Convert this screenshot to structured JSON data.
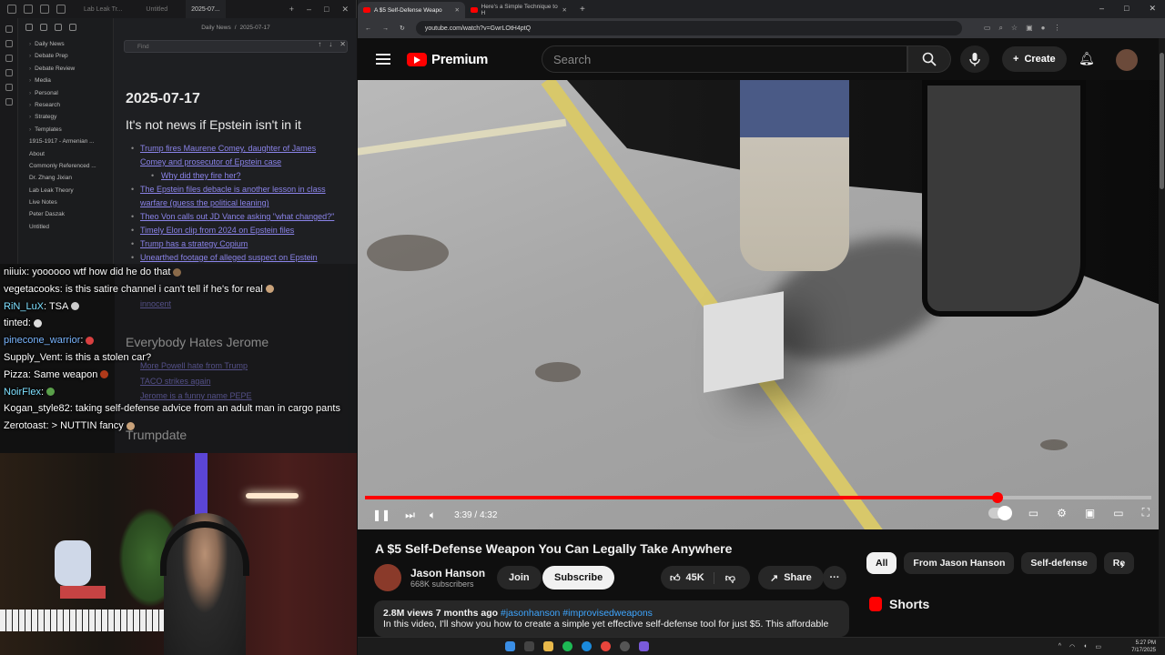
{
  "notes_app": {
    "tabs": [
      "Lab Leak Tr...",
      "Untitled",
      "2025-07..."
    ],
    "breadcrumb": [
      "Daily News",
      "/",
      "2025-07-17"
    ],
    "find_placeholder": "Find",
    "file_tree": [
      "Daily News",
      "Debate Prep",
      "Debate Review",
      "Media",
      "Personal",
      "Research",
      "Strategy",
      "Templates",
      "1915-1917 - Armenian ...",
      "About",
      "Commonly Referenced ...",
      "Dr. Zhang Jixian",
      "Lab Leak Theory",
      "Live Notes",
      "Peter Daszak",
      "Untitled"
    ],
    "file_tree_folders": 8,
    "date_heading": "2025-07-17",
    "section1_heading": "It's not news if Epstein isn't in it",
    "section1_links": [
      {
        "text": "Trump fires Maurene Comey, daughter of James Comey and prosecutor of Epstein case",
        "sub": false
      },
      {
        "text": "Why did they fire her?",
        "sub": true
      },
      {
        "text": "The Epstein files debacle is another lesson in class warfare (guess the political leaning)",
        "sub": false
      },
      {
        "text": "Theo Von calls out JD Vance asking \"what changed?\"",
        "sub": false
      },
      {
        "text": "Timely Elon clip from 2024 on Epstein files",
        "sub": false
      },
      {
        "text": "Trump has a strategy Copium",
        "sub": false
      },
      {
        "text": "Unearthed footage of alleged suspect on Epstein",
        "sub": false
      }
    ],
    "section1_tail": "innocent",
    "section2_heading": "Everybody Hates Jerome",
    "section2_links": [
      "More Powell hate from Trump",
      "TACO strikes again",
      "Jerome is a funny name PEPE"
    ],
    "section3_heading": "Trumpdate"
  },
  "chat": [
    {
      "user": "niiuix",
      "user_color": "#ffffff",
      "text": " yoooooo wtf how did he do that",
      "emote": "#8a6a4a"
    },
    {
      "user": "vegetacooks",
      "user_color": "#ffffff",
      "text": " is this satire channel i can't tell if he's for real",
      "emote": "#c9a27a"
    },
    {
      "user": "RiN_LuX",
      "user_color": "#7ee0ff",
      "text": " TSA",
      "emote": "#cccccc"
    },
    {
      "user": "tinted",
      "user_color": "#ffffff",
      "text": "",
      "emote": "#dddddd"
    },
    {
      "user": "pinecone_warrior",
      "user_color": "#7ab6ff",
      "text": "",
      "emote": "#d94040"
    },
    {
      "user": "Supply_Vent",
      "user_color": "#ffffff",
      "text": " is this a stolen car?",
      "emote": ""
    },
    {
      "user": "Pizza",
      "user_color": "#ffffff",
      "text": " Same weapon",
      "emote": "#b03a1a"
    },
    {
      "user": "NoirFlex",
      "user_color": "#7ee0ff",
      "text": "",
      "emote": "#5aa04a"
    },
    {
      "user": "Kogan_style82",
      "user_color": "#ffffff",
      "text": " taking self-defense advice from an adult man in cargo pants",
      "emote": ""
    },
    {
      "user": "Zerotoast",
      "user_color": "#ffffff",
      "text": " > NUTTIN fancy",
      "emote": "#c9a27a"
    }
  ],
  "browser": {
    "tabs": [
      {
        "title": "A $5 Self-Defense Weapo",
        "active": true
      },
      {
        "title": "Here's a Simple Technique to H",
        "active": false
      }
    ],
    "new_tab": "+",
    "url": "youtube.com/watch?v=GwrLOtH4ptQ",
    "window_controls": [
      "–",
      "□",
      "✕"
    ]
  },
  "youtube": {
    "brand": "Premium",
    "search_placeholder": "Search",
    "create_label": "Create",
    "video": {
      "current_time": "3:39",
      "duration": "4:32",
      "progress": 0.804,
      "title": "A $5 Self-Defense Weapon You Can Legally Take Anywhere"
    },
    "channel": {
      "name": "Jason Hanson",
      "subscribers": "668K subscribers"
    },
    "join_label": "Join",
    "subscribe_label": "Subscribe",
    "likes": "45K",
    "share_label": "Share",
    "description": {
      "views": "2.8M views",
      "age": "7 months ago",
      "tags": "#jasonhanson #improvisedweapons",
      "text": "In this video, I'll show you how to create a simple yet effective self-defense tool for just $5. This affordable"
    },
    "chips": [
      {
        "label": "All",
        "active": true
      },
      {
        "label": "From Jason Hanson",
        "active": false
      },
      {
        "label": "Self-defense",
        "active": false
      },
      {
        "label": "Re",
        "active": false
      }
    ],
    "shorts_label": "Shorts"
  },
  "taskbar": {
    "time": "5:27 PM",
    "date": "7/17/2025"
  },
  "colors": {
    "yt_red": "#ff0000",
    "link_purple": "#8a83e8",
    "webcam_accent": "#5b45d6"
  }
}
